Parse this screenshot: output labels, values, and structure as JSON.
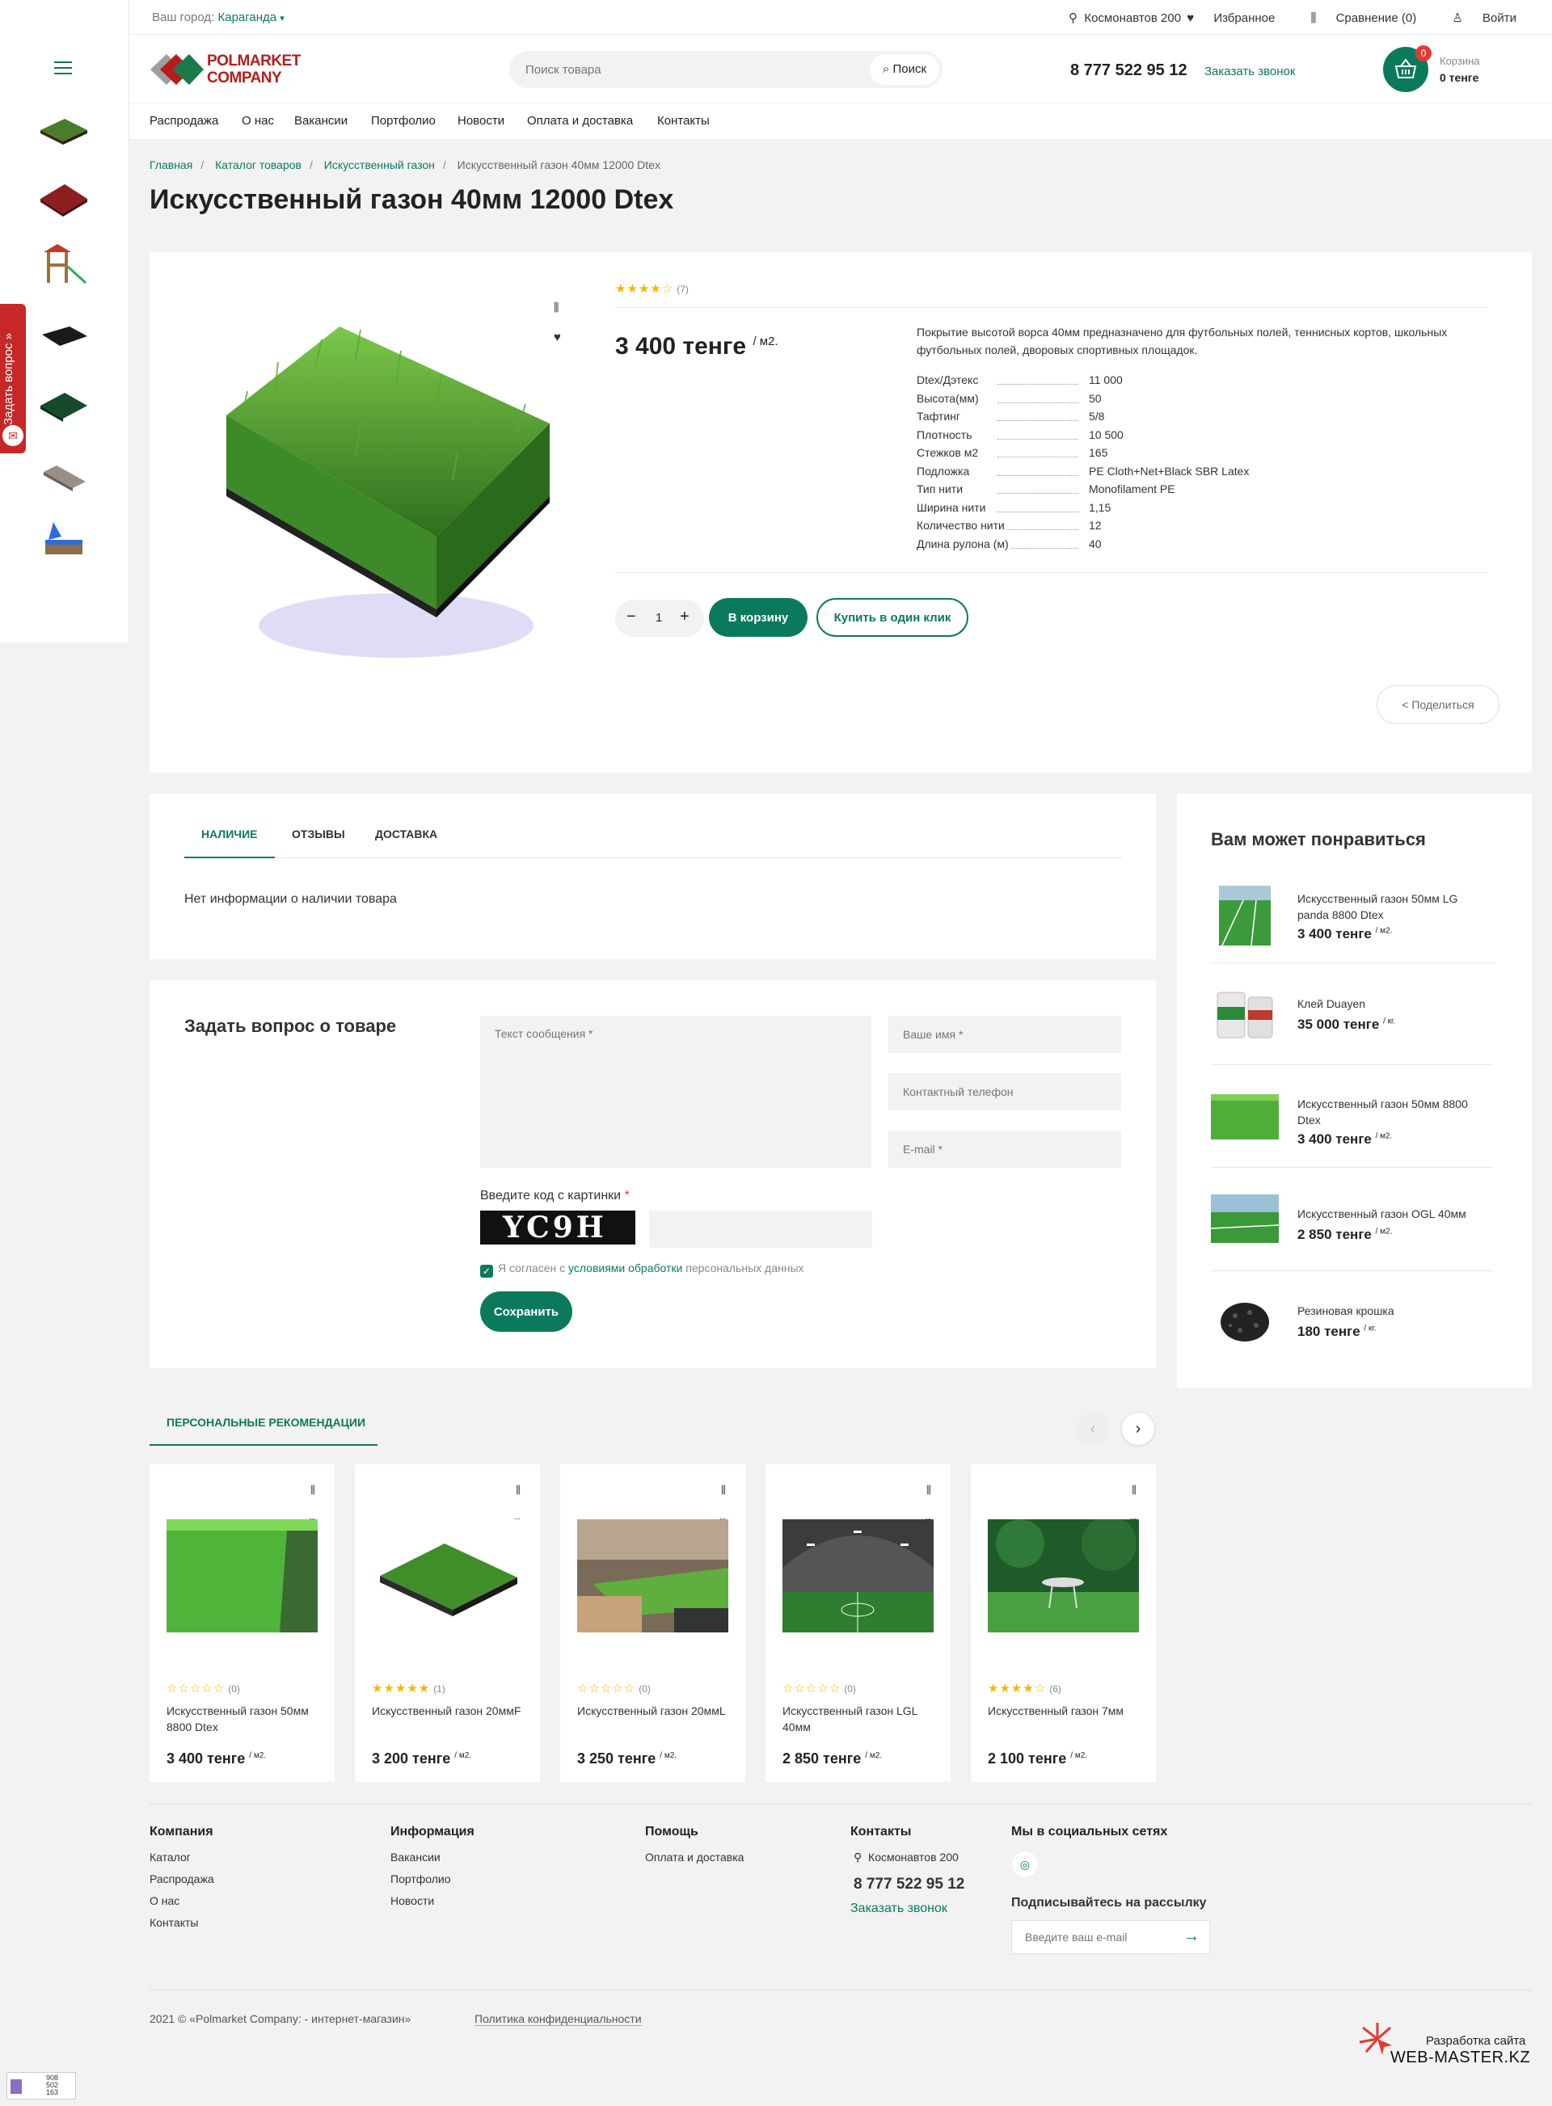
{
  "topbar": {
    "city_label": "Ваш город:",
    "city": "Караганда",
    "address": "Космонавтов 200",
    "favorites": "Избранное",
    "compare": "Сравнение (0)",
    "login": "Войти"
  },
  "header": {
    "logo_line1": "POLMARKET",
    "logo_line2": "COMPANY",
    "search_placeholder": "Поиск товара",
    "search_button": "Поиск",
    "phone": "8 777 522 95 12",
    "callback": "Заказать звонок",
    "cart_count": "0",
    "cart_label": "Корзина",
    "cart_sum": "0 тенге"
  },
  "nav": [
    "Распродажа",
    "О нас",
    "Вакансии",
    "Портфолио",
    "Новости",
    "Оплата и доставка",
    "Контакты"
  ],
  "sidebar": {
    "ask_label": "Задать вопрос »"
  },
  "breadcrumbs": [
    "Главная",
    "Каталог товаров",
    "Искусственный газон",
    "Искусственный газон 40мм 12000 Dtex"
  ],
  "product": {
    "title": "Искусственный газон 40мм 12000 Dtex",
    "rating": 4,
    "stars": "★★★★☆",
    "rating_count": "(7)",
    "price": "3 400 тенге",
    "unit": "/ м2.",
    "description": "Покрытие высотой ворса 40мм предназначено для футбольных полей, теннисных кортов, школьных футбольных полей, дворовых спортивных площадок.",
    "props": [
      {
        "name": "Dtex/Дэтекс",
        "value": "11 000"
      },
      {
        "name": "Высота(мм)",
        "value": "50"
      },
      {
        "name": "Тафтинг",
        "value": "5/8"
      },
      {
        "name": "Плотность",
        "value": "10 500"
      },
      {
        "name": "Стежков м2",
        "value": "165"
      },
      {
        "name": "Подложка",
        "value": "PE Cloth+Net+Black SBR Latex"
      },
      {
        "name": "Тип нити",
        "value": "Monofilament PE"
      },
      {
        "name": "Ширина нити",
        "value": "1,15"
      },
      {
        "name": "Количество нити",
        "value": "12"
      },
      {
        "name": "Длина рулона (м)",
        "value": "40"
      }
    ],
    "quantity": "1",
    "add_to_cart": "В корзину",
    "one_click": "Купить в один клик",
    "share": "Поделиться"
  },
  "tabs": {
    "items": [
      "НАЛИЧИЕ",
      "ОТЗЫВЫ",
      "ДОСТАВКА"
    ],
    "active_text": "Нет информации о наличии товара"
  },
  "ask_form": {
    "title": "Задать вопрос о товаре",
    "message_placeholder": "Текст сообщения *",
    "name_placeholder": "Ваше имя *",
    "phone_placeholder": "Контактный телефон",
    "email_placeholder": "E-mail *",
    "captcha_label": "Введите код с картинки",
    "captcha_text": "YC9H",
    "agree_prefix": "Я согласен с",
    "agree_link": "условиями обработки",
    "agree_suffix": "персональных данных",
    "submit": "Сохранить"
  },
  "may_like": {
    "title": "Вам может понравиться",
    "items": [
      {
        "name": "Искусственный газон 50мм LG panda 8800 Dtex",
        "price": "3 400 тенге",
        "unit": "/ м2."
      },
      {
        "name": "Клей Duayen",
        "price": "35 000 тенге",
        "unit": "/ кг."
      },
      {
        "name": "Искусственный газон 50мм 8800 Dtex",
        "price": "3 400 тенге",
        "unit": "/ м2."
      },
      {
        "name": "Искусственный газон OGL 40мм",
        "price": "2 850 тенге",
        "unit": "/ м2."
      },
      {
        "name": "Резиновая крошка",
        "price": "180 тенге",
        "unit": "/ кг."
      }
    ]
  },
  "recommendations": {
    "title": "ПЕРСОНАЛЬНЫЕ РЕКОМЕНДАЦИИ",
    "items": [
      {
        "name": "Искусственный газон 50мм 8800 Dtex",
        "stars": "☆☆☆☆☆",
        "rating": 0,
        "count": "(0)",
        "price": "3 400 тенге",
        "unit": "/ м2."
      },
      {
        "name": "Искусственный газон 20ммF",
        "stars": "★★★★★",
        "rating": 5,
        "count": "(1)",
        "price": "3 200 тенге",
        "unit": "/ м2."
      },
      {
        "name": "Искусственный газон 20ммL",
        "stars": "☆☆☆☆☆",
        "rating": 0,
        "count": "(0)",
        "price": "3 250 тенге",
        "unit": "/ м2."
      },
      {
        "name": "Искусственный газон LGL 40мм",
        "stars": "☆☆☆☆☆",
        "rating": 0,
        "count": "(0)",
        "price": "2 850 тенге",
        "unit": "/ м2."
      },
      {
        "name": "Искусственный газон 7мм",
        "stars": "★★★★☆",
        "rating": 4,
        "count": "(6)",
        "price": "2 100 тенге",
        "unit": "/ м2."
      }
    ]
  },
  "footer": {
    "company": {
      "title": "Компания",
      "links": [
        "Каталог",
        "Распродажа",
        "О нас",
        "Контакты"
      ]
    },
    "info": {
      "title": "Информация",
      "links": [
        "Вакансии",
        "Портфолио",
        "Новости"
      ]
    },
    "help": {
      "title": "Помощь",
      "links": [
        "Оплата и доставка"
      ]
    },
    "contacts": {
      "title": "Контакты",
      "address": "Космонавтов 200",
      "phone": "8 777 522 95 12",
      "callback": "Заказать звонок"
    },
    "social": {
      "title": "Мы в социальных сетях",
      "subscribe_title": "Подписывайтесь на рассылку",
      "email_placeholder": "Введите ваш e-mail"
    },
    "copyright": "2021 © «Polmarket Company: - интернет-магазин»",
    "policy": "Политика конфиденциальности",
    "dev_label": "Разработка сайта",
    "dev_name": "WEB-MASTER.KZ",
    "counter": [
      "908",
      "502",
      "163"
    ]
  },
  "colors": {
    "accent": "#0b7a5c",
    "brand_red": "#b71c1c",
    "star": "#f7b500"
  }
}
